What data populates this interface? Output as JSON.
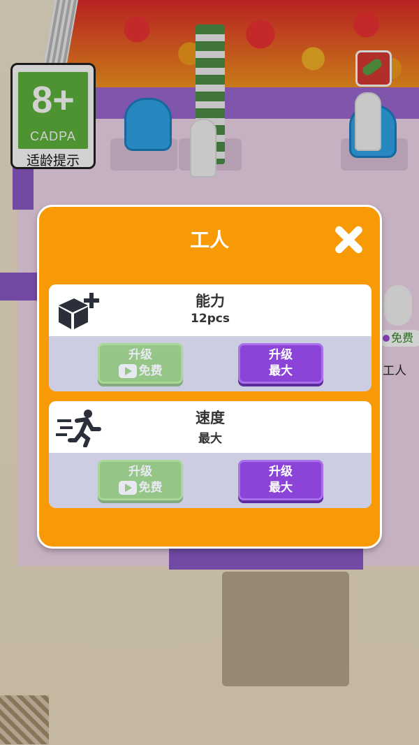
{
  "age_rating": {
    "number": "8+",
    "org": "CADPA",
    "caption": "适龄提示"
  },
  "background": {
    "peek_badge_label": "免费",
    "peek_worker_label": "工人"
  },
  "dialog": {
    "title": "工人",
    "close_icon": "close-x-icon",
    "cards": [
      {
        "icon": "box-plus-icon",
        "name": "能力",
        "value": "12pcs",
        "free_button": {
          "line1": "升级",
          "line2": "免费",
          "icon": "video-play-icon"
        },
        "max_button": {
          "line1": "升级",
          "line2": "最大"
        }
      },
      {
        "icon": "running-person-icon",
        "name": "速度",
        "value": "最大",
        "free_button": {
          "line1": "升级",
          "line2": "免费",
          "icon": "video-play-icon"
        },
        "max_button": {
          "line1": "升级",
          "line2": "最大"
        }
      }
    ]
  },
  "colors": {
    "panel": "#f89a06",
    "free_button": "#6ac240",
    "max_button": "#8b44d7",
    "age_green": "#5fb43d"
  }
}
